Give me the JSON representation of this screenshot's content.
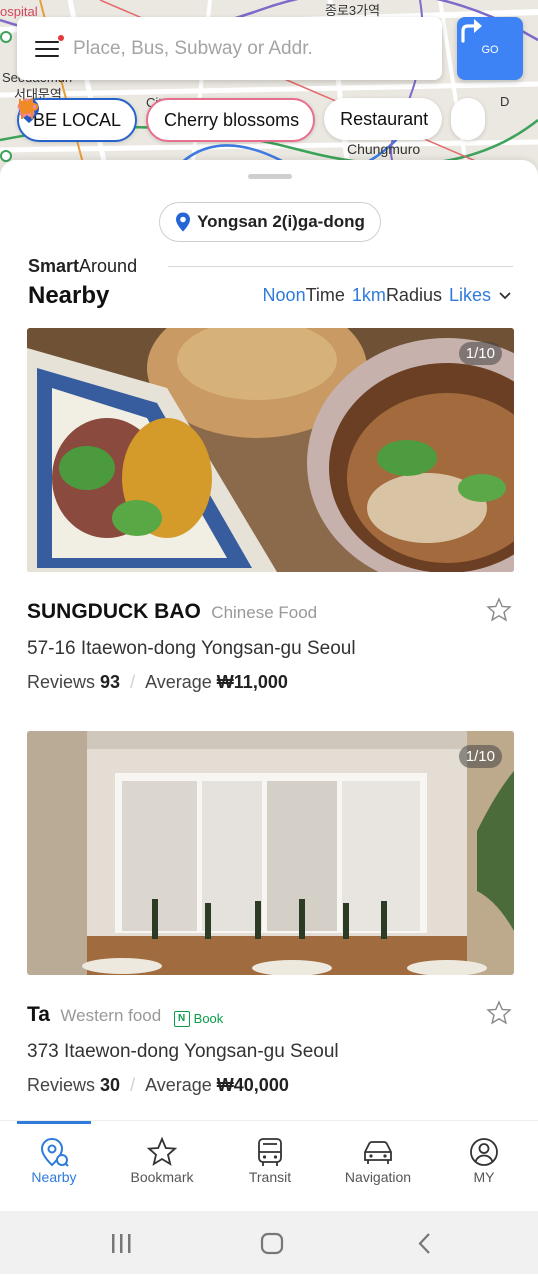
{
  "map": {
    "labels": [
      "ospital",
      "종로3가역",
      "Seodaemun",
      "서대문역",
      "City",
      "Chungmuro",
      "D"
    ]
  },
  "search": {
    "placeholder": "Place, Bus, Subway or Addr."
  },
  "go_button": {
    "label": "GO"
  },
  "chips": [
    {
      "label": "BE LOCAL",
      "icon": "location-pin-n-icon"
    },
    {
      "label": "Cherry blossoms",
      "icon": "cherry-blossom-icon"
    },
    {
      "label": "Restaurant",
      "icon": "fork-knife-icon"
    }
  ],
  "location": {
    "label": "Yongsan 2(i)ga-dong"
  },
  "section": {
    "brand_bold": "Smart",
    "brand_light": "Around",
    "title": "Nearby",
    "filter_time_value": "Noon",
    "filter_time_label": "Time",
    "filter_radius_value": "1km",
    "filter_radius_label": "Radius",
    "filter_sort": "Likes"
  },
  "places": [
    {
      "name": "SUNGDUCK BAO",
      "category": "Chinese Food",
      "address": "57-16 Itaewon-dong Yongsan-gu Seoul",
      "reviews_label": "Reviews",
      "reviews": "93",
      "average_label": "Average",
      "average": "₩11,000",
      "photo_counter": "1/10",
      "book": ""
    },
    {
      "name": "Ta",
      "category": "Western food",
      "address": "373 Itaewon-dong Yongsan-gu Seoul",
      "reviews_label": "Reviews",
      "reviews": "30",
      "average_label": "Average",
      "average": "₩40,000",
      "photo_counter": "1/10",
      "book": "Book"
    }
  ],
  "tabs": [
    {
      "label": "Nearby",
      "icon": "nearby-pin-icon",
      "active": true
    },
    {
      "label": "Bookmark",
      "icon": "star-icon",
      "active": false
    },
    {
      "label": "Transit",
      "icon": "bus-icon",
      "active": false
    },
    {
      "label": "Navigation",
      "icon": "car-icon",
      "active": false
    },
    {
      "label": "MY",
      "icon": "user-icon",
      "active": false
    }
  ],
  "colors": {
    "accent": "#2e7bdc",
    "go": "#3d83f5",
    "book": "#0b9d48"
  }
}
